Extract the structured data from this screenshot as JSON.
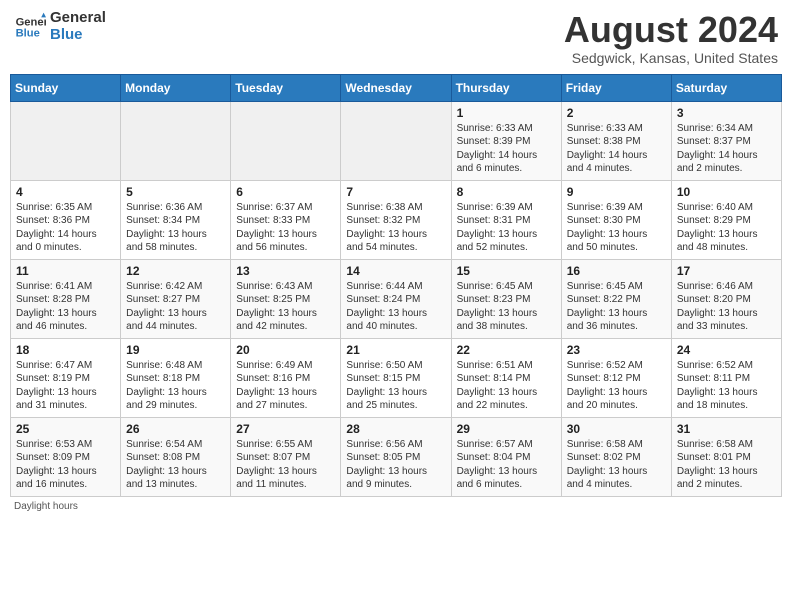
{
  "header": {
    "logo_line1": "General",
    "logo_line2": "Blue",
    "month_year": "August 2024",
    "location": "Sedgwick, Kansas, United States"
  },
  "days_of_week": [
    "Sunday",
    "Monday",
    "Tuesday",
    "Wednesday",
    "Thursday",
    "Friday",
    "Saturday"
  ],
  "weeks": [
    [
      {
        "day": "",
        "info": ""
      },
      {
        "day": "",
        "info": ""
      },
      {
        "day": "",
        "info": ""
      },
      {
        "day": "",
        "info": ""
      },
      {
        "day": "1",
        "info": "Sunrise: 6:33 AM\nSunset: 8:39 PM\nDaylight: 14 hours and 6 minutes."
      },
      {
        "day": "2",
        "info": "Sunrise: 6:33 AM\nSunset: 8:38 PM\nDaylight: 14 hours and 4 minutes."
      },
      {
        "day": "3",
        "info": "Sunrise: 6:34 AM\nSunset: 8:37 PM\nDaylight: 14 hours and 2 minutes."
      }
    ],
    [
      {
        "day": "4",
        "info": "Sunrise: 6:35 AM\nSunset: 8:36 PM\nDaylight: 14 hours and 0 minutes."
      },
      {
        "day": "5",
        "info": "Sunrise: 6:36 AM\nSunset: 8:34 PM\nDaylight: 13 hours and 58 minutes."
      },
      {
        "day": "6",
        "info": "Sunrise: 6:37 AM\nSunset: 8:33 PM\nDaylight: 13 hours and 56 minutes."
      },
      {
        "day": "7",
        "info": "Sunrise: 6:38 AM\nSunset: 8:32 PM\nDaylight: 13 hours and 54 minutes."
      },
      {
        "day": "8",
        "info": "Sunrise: 6:39 AM\nSunset: 8:31 PM\nDaylight: 13 hours and 52 minutes."
      },
      {
        "day": "9",
        "info": "Sunrise: 6:39 AM\nSunset: 8:30 PM\nDaylight: 13 hours and 50 minutes."
      },
      {
        "day": "10",
        "info": "Sunrise: 6:40 AM\nSunset: 8:29 PM\nDaylight: 13 hours and 48 minutes."
      }
    ],
    [
      {
        "day": "11",
        "info": "Sunrise: 6:41 AM\nSunset: 8:28 PM\nDaylight: 13 hours and 46 minutes."
      },
      {
        "day": "12",
        "info": "Sunrise: 6:42 AM\nSunset: 8:27 PM\nDaylight: 13 hours and 44 minutes."
      },
      {
        "day": "13",
        "info": "Sunrise: 6:43 AM\nSunset: 8:25 PM\nDaylight: 13 hours and 42 minutes."
      },
      {
        "day": "14",
        "info": "Sunrise: 6:44 AM\nSunset: 8:24 PM\nDaylight: 13 hours and 40 minutes."
      },
      {
        "day": "15",
        "info": "Sunrise: 6:45 AM\nSunset: 8:23 PM\nDaylight: 13 hours and 38 minutes."
      },
      {
        "day": "16",
        "info": "Sunrise: 6:45 AM\nSunset: 8:22 PM\nDaylight: 13 hours and 36 minutes."
      },
      {
        "day": "17",
        "info": "Sunrise: 6:46 AM\nSunset: 8:20 PM\nDaylight: 13 hours and 33 minutes."
      }
    ],
    [
      {
        "day": "18",
        "info": "Sunrise: 6:47 AM\nSunset: 8:19 PM\nDaylight: 13 hours and 31 minutes."
      },
      {
        "day": "19",
        "info": "Sunrise: 6:48 AM\nSunset: 8:18 PM\nDaylight: 13 hours and 29 minutes."
      },
      {
        "day": "20",
        "info": "Sunrise: 6:49 AM\nSunset: 8:16 PM\nDaylight: 13 hours and 27 minutes."
      },
      {
        "day": "21",
        "info": "Sunrise: 6:50 AM\nSunset: 8:15 PM\nDaylight: 13 hours and 25 minutes."
      },
      {
        "day": "22",
        "info": "Sunrise: 6:51 AM\nSunset: 8:14 PM\nDaylight: 13 hours and 22 minutes."
      },
      {
        "day": "23",
        "info": "Sunrise: 6:52 AM\nSunset: 8:12 PM\nDaylight: 13 hours and 20 minutes."
      },
      {
        "day": "24",
        "info": "Sunrise: 6:52 AM\nSunset: 8:11 PM\nDaylight: 13 hours and 18 minutes."
      }
    ],
    [
      {
        "day": "25",
        "info": "Sunrise: 6:53 AM\nSunset: 8:09 PM\nDaylight: 13 hours and 16 minutes."
      },
      {
        "day": "26",
        "info": "Sunrise: 6:54 AM\nSunset: 8:08 PM\nDaylight: 13 hours and 13 minutes."
      },
      {
        "day": "27",
        "info": "Sunrise: 6:55 AM\nSunset: 8:07 PM\nDaylight: 13 hours and 11 minutes."
      },
      {
        "day": "28",
        "info": "Sunrise: 6:56 AM\nSunset: 8:05 PM\nDaylight: 13 hours and 9 minutes."
      },
      {
        "day": "29",
        "info": "Sunrise: 6:57 AM\nSunset: 8:04 PM\nDaylight: 13 hours and 6 minutes."
      },
      {
        "day": "30",
        "info": "Sunrise: 6:58 AM\nSunset: 8:02 PM\nDaylight: 13 hours and 4 minutes."
      },
      {
        "day": "31",
        "info": "Sunrise: 6:58 AM\nSunset: 8:01 PM\nDaylight: 13 hours and 2 minutes."
      }
    ]
  ],
  "footer": "Daylight hours"
}
